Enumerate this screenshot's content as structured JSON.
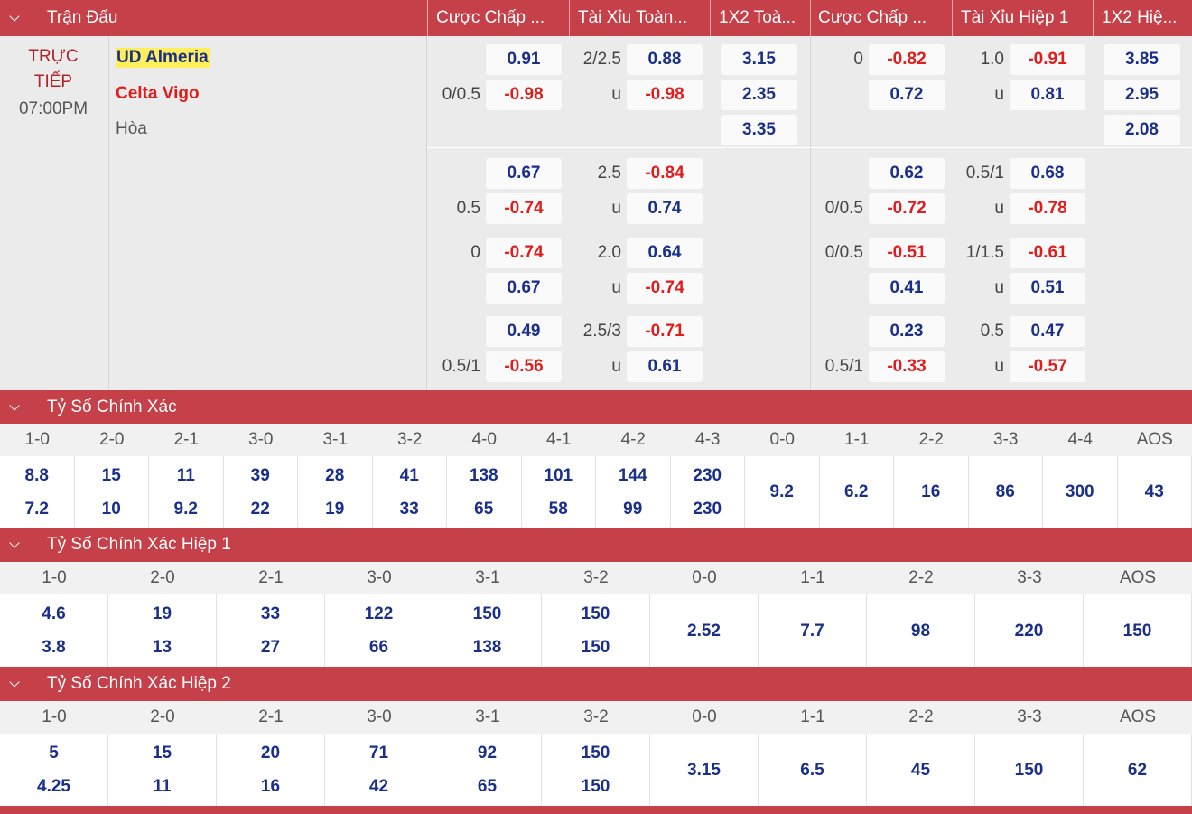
{
  "header": {
    "match_col": "Trận Đấu",
    "cols": [
      "Cược Chấp ...",
      "Tài Xỉu Toàn...",
      "1X2 Toà...",
      "Cược Chấp ...",
      "Tài Xỉu Hiệp 1",
      "1X2 Hiệ..."
    ]
  },
  "match": {
    "status_line1": "TRỰC",
    "status_line2": "TIẾP",
    "time": "07:00PM",
    "home": "UD Almeria",
    "away": "Celta Vigo",
    "draw": "Hòa"
  },
  "markets": {
    "ft_hdp": [
      {
        "line": "",
        "odd": "0.91"
      },
      {
        "line": "0/0.5",
        "odd": "-0.98"
      },
      {
        "line": "",
        "odd": "0.67"
      },
      {
        "line": "0.5",
        "odd": "-0.74"
      },
      {
        "line": "0",
        "odd": "-0.74"
      },
      {
        "line": "",
        "odd": "0.67"
      },
      {
        "line": "",
        "odd": "0.49"
      },
      {
        "line": "0.5/1",
        "odd": "-0.56"
      }
    ],
    "ft_ou": [
      {
        "line": "2/2.5",
        "odd": "0.88"
      },
      {
        "line": "u",
        "odd": "-0.98"
      },
      {
        "line": "2.5",
        "odd": "-0.84"
      },
      {
        "line": "u",
        "odd": "0.74"
      },
      {
        "line": "2.0",
        "odd": "0.64"
      },
      {
        "line": "u",
        "odd": "-0.74"
      },
      {
        "line": "2.5/3",
        "odd": "-0.71"
      },
      {
        "line": "u",
        "odd": "0.61"
      }
    ],
    "ft_1x2": [
      "3.15",
      "2.35",
      "3.35"
    ],
    "h1_hdp": [
      {
        "line": "0",
        "odd": "-0.82"
      },
      {
        "line": "",
        "odd": "0.72"
      },
      {
        "line": "",
        "odd": "0.62"
      },
      {
        "line": "0/0.5",
        "odd": "-0.72"
      },
      {
        "line": "0/0.5",
        "odd": "-0.51"
      },
      {
        "line": "",
        "odd": "0.41"
      },
      {
        "line": "",
        "odd": "0.23"
      },
      {
        "line": "0.5/1",
        "odd": "-0.33"
      }
    ],
    "h1_ou": [
      {
        "line": "1.0",
        "odd": "-0.91"
      },
      {
        "line": "u",
        "odd": "0.81"
      },
      {
        "line": "0.5/1",
        "odd": "0.68"
      },
      {
        "line": "u",
        "odd": "-0.78"
      },
      {
        "line": "1/1.5",
        "odd": "-0.61"
      },
      {
        "line": "u",
        "odd": "0.51"
      },
      {
        "line": "0.5",
        "odd": "0.47"
      },
      {
        "line": "u",
        "odd": "-0.57"
      }
    ],
    "h1_1x2": [
      "3.85",
      "2.95",
      "2.08"
    ]
  },
  "correct_score": {
    "title": "Tỷ Số Chính Xác",
    "labels": [
      "1-0",
      "2-0",
      "2-1",
      "3-0",
      "3-1",
      "3-2",
      "4-0",
      "4-1",
      "4-2",
      "4-3",
      "0-0",
      "1-1",
      "2-2",
      "3-3",
      "4-4",
      "AOS"
    ],
    "top": [
      "8.8",
      "15",
      "11",
      "39",
      "28",
      "41",
      "138",
      "101",
      "144",
      "230",
      "9.2",
      "6.2",
      "16",
      "86",
      "300",
      "43"
    ],
    "bottom": [
      "7.2",
      "10",
      "9.2",
      "22",
      "19",
      "33",
      "65",
      "58",
      "99",
      "230",
      "",
      "",
      "",
      "",
      "",
      ""
    ]
  },
  "correct_score_h1": {
    "title": "Tỷ Số Chính Xác Hiệp 1",
    "labels": [
      "1-0",
      "2-0",
      "2-1",
      "3-0",
      "3-1",
      "3-2",
      "0-0",
      "1-1",
      "2-2",
      "3-3",
      "AOS"
    ],
    "top": [
      "4.6",
      "19",
      "33",
      "122",
      "150",
      "150",
      "2.52",
      "7.7",
      "98",
      "220",
      "150"
    ],
    "bottom": [
      "3.8",
      "13",
      "27",
      "66",
      "138",
      "150",
      "",
      "",
      "",
      "",
      ""
    ]
  },
  "correct_score_h2": {
    "title": "Tỷ Số Chính Xác Hiệp 2",
    "labels": [
      "1-0",
      "2-0",
      "2-1",
      "3-0",
      "3-1",
      "3-2",
      "0-0",
      "1-1",
      "2-2",
      "3-3",
      "AOS"
    ],
    "top": [
      "5",
      "15",
      "20",
      "71",
      "92",
      "150",
      "3.15",
      "6.5",
      "45",
      "150",
      "62"
    ],
    "bottom": [
      "4.25",
      "11",
      "16",
      "42",
      "65",
      "150",
      "",
      "",
      "",
      "",
      ""
    ]
  },
  "colors": {
    "header_red": "#c64049",
    "positive_odd": "#1a2f8a",
    "negative_odd": "#e01c1c",
    "live_status": "#b0232a",
    "home_highlight": "#ffef5a"
  }
}
